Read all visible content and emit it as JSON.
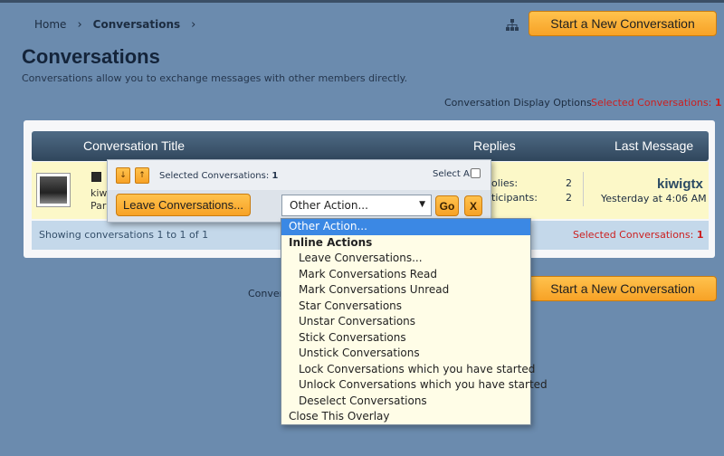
{
  "breadcrumb": {
    "home": "Home",
    "separator": "›",
    "current": "Conversations"
  },
  "actions": {
    "start_new": "Start a New Conversation"
  },
  "page": {
    "title": "Conversations",
    "description": "Conversations allow you to exchange messages with other members directly.",
    "display_options": "Conversation Display Options",
    "selected_label": "Selected Conversations:",
    "selected_count": "1"
  },
  "table": {
    "headers": {
      "title": "Conversation Title",
      "replies": "Replies",
      "last_message": "Last Message"
    },
    "row": {
      "title_fragment": "kiw",
      "meta_fragment": "Par",
      "replies_label": "olies:",
      "replies_value": "2",
      "participants_label": "ticipants:",
      "participants_value": "2",
      "last_user": "kiwigtx",
      "last_time": "Yesterday at 4:06 AM"
    },
    "footer": {
      "showing": "Showing conversations 1 to 1 of 1",
      "selected_label": "Selected Conversations:",
      "selected_count": "1"
    }
  },
  "overlay": {
    "selected_label": "Selected Conversations:",
    "selected_count": "1",
    "select_all": "Select All",
    "leave_button": "Leave Conversations...",
    "select_value": "Other Action...",
    "go": "Go",
    "close": "X"
  },
  "dropdown": {
    "options": [
      {
        "label": "Other Action...",
        "kind": "selected"
      },
      {
        "label": "Inline Actions",
        "kind": "group"
      },
      {
        "label": "Leave Conversations...",
        "kind": "option"
      },
      {
        "label": "Mark Conversations Read",
        "kind": "option"
      },
      {
        "label": "Mark Conversations Unread",
        "kind": "option"
      },
      {
        "label": "Star Conversations",
        "kind": "option"
      },
      {
        "label": "Unstar Conversations",
        "kind": "option"
      },
      {
        "label": "Stick Conversations",
        "kind": "option"
      },
      {
        "label": "Unstick Conversations",
        "kind": "option"
      },
      {
        "label": "Lock Conversations which you have started",
        "kind": "option"
      },
      {
        "label": "Unlock Conversations which you have started",
        "kind": "option"
      },
      {
        "label": "Deselect Conversations",
        "kind": "option"
      },
      {
        "label": "Close This Overlay",
        "kind": "plain"
      }
    ]
  },
  "fragments": {
    "bottom_left": "Conver"
  },
  "colors": {
    "background": "#6b8bae",
    "accent_orange": "#f7a226",
    "selected_red": "#cc1f1f",
    "header_dark": "#30465c",
    "row_highlight": "#fcf8c8",
    "dropdown_selected": "#3b88e4"
  }
}
